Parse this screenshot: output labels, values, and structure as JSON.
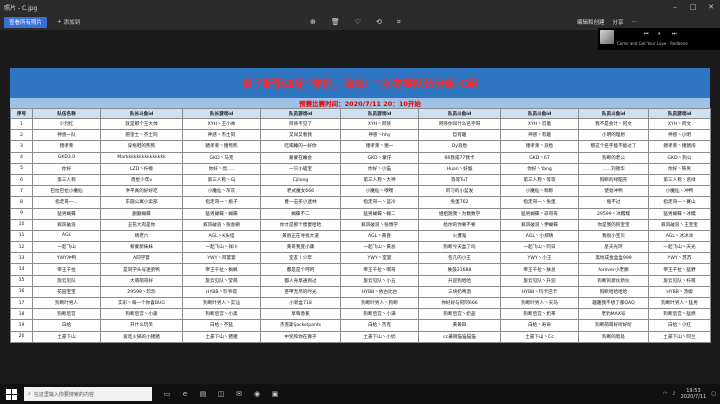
{
  "window": {
    "title": "照片 - C.jpg"
  },
  "toolbar": {
    "new_video": "查看所有照片",
    "add": "添加到",
    "edit_create": "编辑和创建",
    "share": "分享",
    "print": "打印"
  },
  "media": {
    "song": "Come and Get Your Love · Redbone"
  },
  "doc": {
    "title": "浪子断第四届“你好，海岛！”水友赛队伍分组-C组",
    "match_time": "预赛比赛时间：2020/7/11  20：10开始",
    "headers": [
      "序号",
      "队伍名称",
      "队长斗鱼id",
      "队长游戏id",
      "队员游戏id",
      "队员游戏id",
      "队员斗鱼id",
      "队员斗鱼id",
      "队员游戏id"
    ],
    "rows": [
      [
        "1",
        "少烈红",
        "就是那个王大帅",
        "XYH丶王小帅",
        "阿哆不见了",
        "XYH丶阿哆",
        "阿哆你叫什么名字呀",
        "XYH丶忍着",
        "我不是会计丶阿文",
        "XYH丶阿文"
      ],
      [
        "2",
        "神感一队",
        "愿望士丶杰士同",
        "神感丶杰士同",
        "又叫又看我",
        "神感丶hhy",
        "哲有趣",
        "神感丶有趣",
        "小明的理想",
        "神感丶小明"
      ],
      [
        "3",
        "猪孝莱",
        "穿拖鞋的熊熊",
        "猪孝莱丶猪熊熊",
        "吃喝睡的一好你",
        "猪孝莱丶猪一",
        "Dy浪愁",
        "猪孝莱丶浪愁",
        "那这个名字能不能过了",
        "猪孝莱丶猪猪闹"
      ],
      [
        "4",
        "GKD3.0",
        "Markkkkkkkkkkkkkkk",
        "GKD丶马克",
        "蒙蒙在睡会",
        "GKD丶蒙仔",
        "66我咸77我卡",
        "GKD丶67",
        "狗断的老公",
        "GKD丶狗公"
      ],
      [
        "5",
        "你好",
        "LZD丶柠檬",
        "你好丶侃.....",
        "一只小喵宝",
        "你好丶小猫",
        "Huan丶好尴",
        "你好丶Yang",
        "......刘德华",
        "你好丶铁男"
      ],
      [
        "6",
        "第三人称",
        "周星少年v",
        "第三人称丶Gj",
        "Cjilong",
        "第三人称丶大神",
        "等等TuT",
        "第三人称丶等等",
        "狗断的绿脑壳",
        "第三人称丶恶绿"
      ],
      [
        "7",
        "巴拉巴拉小魔仙",
        "洪平真的好好吃",
        "小魔仙丶灰灰",
        "老式魔女666",
        "小魔仙丶嘿嘿",
        "阿刁的小蓝发",
        "小魔仙丶粽粽",
        "使劲冲鸭",
        "小魔仙丶冲鸭"
      ],
      [
        "8",
        "指走哥一...",
        "东圆公寓小卖部",
        "指走哥一丶瓶子",
        "曹一击买小迷林",
        "指走哥一丶蓝冷",
        "免蛋762",
        "指走哥一丶免蛋",
        "瓶不过",
        "指走哥一丶赛山"
      ],
      [
        "9",
        "猛男蝴蝶",
        "蒯蒯蝴蝶",
        "猛男蝴蝶丶蝴蝶",
        "蝴蝶不二",
        "猛男蝴蝶丶蝴二",
        "姐姐跑我丶为数数学",
        "猛男蝴蝶丶玖哥哥",
        "29599丶冰糯糯",
        "猛男蝴蝶丶冰糯"
      ],
      [
        "10",
        "疯风破浪",
        "五花大肉是你",
        "疯风破浪丶张会朝",
        "你才是那个傻傻哈哈",
        "疯风破浪丶张博学",
        "给你的你要不要",
        "疯风破浪丶伊蝴蝶",
        "你是我的狗宝宝",
        "疯风破浪丶王宝宝"
      ],
      [
        "11",
        "AGL",
        "晴老六",
        "AGL丶K头怪",
        "黄昏正在寻找大道",
        "AGL丶黄昏",
        "火爆鬼",
        "AGL丶小郑晴",
        "我很小宝贝",
        "AGL丶冰冰冰"
      ],
      [
        "12",
        "一起飞山",
        "黎蒙新妹妹",
        "一起飞山丶祥川",
        "黄哥我变小康",
        "一起飞山丶黄总",
        "狗断今天盒了吗",
        "一起飞山丶阿日",
        "星天光环",
        "一起飞山丶天光"
      ],
      [
        "13",
        "YWY冲鸭",
        "A同学篓",
        "YWY丶阿篓篓",
        "室友丨少年",
        "YWY丶室篓",
        "包几的小王",
        "YWY丶小王",
        "黑地成金盒盒999",
        "YWY丶苏苏"
      ],
      [
        "14",
        "帝王千拉",
        "是同学头号迷弟鸭",
        "帝王千拉丶枫枫",
        "都是是个呵呵",
        "帝王千拉丶啊哥",
        "肤鼓31688",
        "帝王千拉丶肤总",
        "forever小老狮",
        "帝王千拉丶猛野"
      ],
      [
        "15",
        "旋云见队",
        "大萌萌哥好",
        "旋云见队丶莹萌",
        "都人身草通到过",
        "旋云见队丶小五",
        "升迎狗哈哈",
        "旋云见队丶升迎",
        "狗断的新伙新伙",
        "旋云见队丶柠萌"
      ],
      [
        "16",
        "花园宝宝",
        "29599丶珍珍",
        "HYBB丶珍爷得",
        "杏甲无尽的时光",
        "HYBB丶依古比古",
        "三块奶啤酒",
        "HYBB丶玛卡巴卡",
        "狗断哈哈哈哈",
        "HYBB丶汤姆"
      ],
      [
        "17",
        "狗断叶男人",
        "实彩丶每一个你喜BUG",
        "狗断叶男人丶实汕",
        "小新盒718",
        "狗断叶男人丶狗断",
        "你好好与阿阿666",
        "狗断叶男人丶天马",
        "趣趣我不想了膝QAQ",
        "狗断叶男人丶猛男"
      ],
      [
        "18",
        "狗断后宫",
        "狗断后宫丶小骏",
        "狗断后宫丶小黑",
        "草莓香蕉",
        "狗断后宫丶小满",
        "狗断后宫丶奶盖",
        "狗断后宫丶奶茶",
        "老豹MAX号",
        "狗断后宫丶猛燃"
      ],
      [
        "19",
        "白给",
        "开什么玩笑",
        "白给丶不猛",
        "杰克斯ijackelpants",
        "白给丶杰克",
        "黄黄四",
        "白给丶寿命",
        "狗断萌萌好听好听",
        "白给丶小红"
      ],
      [
        "20",
        "土豪下山",
        "爱吃火锅的小猪猪",
        "土豪下山丶猪猪",
        "中奖和你在狮子",
        "土豪下山丶小奶",
        "cc著萌猫猫猫猫",
        "土豪下山丶Cc",
        "狗断的暗处",
        "土豪下山丶阿兰"
      ]
    ]
  },
  "taskbar": {
    "search_placeholder": "在这里输入你要搜索的内容",
    "time": "19:53",
    "date": "2020/7/11"
  },
  "icons": [
    "search-icon",
    "minimize-icon",
    "maximize-icon",
    "close-icon",
    "zoom-in-icon",
    "delete-icon",
    "heart-icon",
    "rotate-icon",
    "crop-icon",
    "more-icon",
    "windows-start-icon"
  ]
}
